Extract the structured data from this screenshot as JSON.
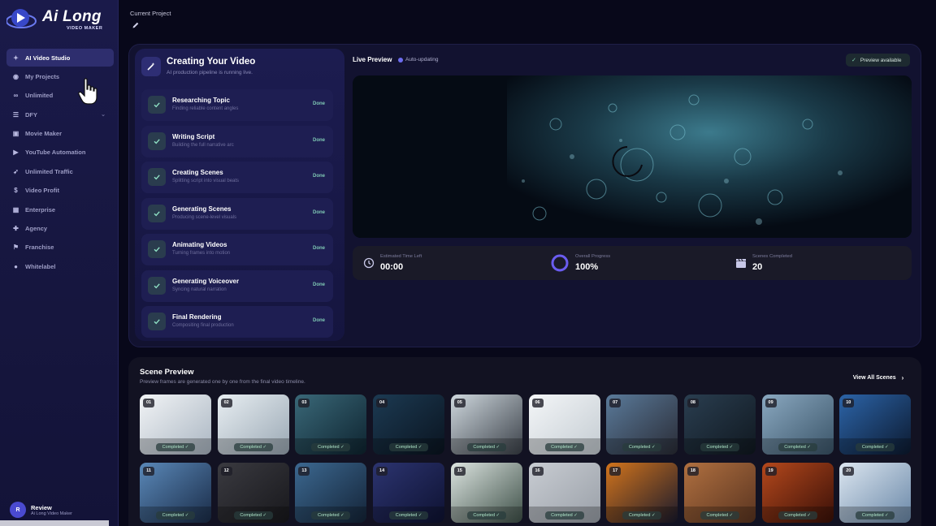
{
  "brand": {
    "name": "Ai Long",
    "subtitle": "VIDEO MAKER"
  },
  "sidebar": {
    "items": [
      {
        "label": "AI Video Studio",
        "icon": "magic-wand-icon",
        "active": true
      },
      {
        "label": "My Projects",
        "icon": "play-circle-icon",
        "active": false
      },
      {
        "label": "Unlimited",
        "icon": "infinity-icon",
        "active": false
      },
      {
        "label": "DFY",
        "icon": "layers-icon",
        "active": false,
        "chevron": true
      },
      {
        "label": "Movie Maker",
        "icon": "film-icon",
        "active": false
      },
      {
        "label": "YouTube Automation",
        "icon": "youtube-icon",
        "active": false
      },
      {
        "label": "Unlimited Traffic",
        "icon": "rocket-icon",
        "active": false
      },
      {
        "label": "Video Profit",
        "icon": "money-bag-icon",
        "active": false
      },
      {
        "label": "Enterprise",
        "icon": "building-icon",
        "active": false
      },
      {
        "label": "Agency",
        "icon": "handshake-icon",
        "active": false
      },
      {
        "label": "Franchise",
        "icon": "flag-icon",
        "active": false
      },
      {
        "label": "Whitelabel",
        "icon": "badge-icon",
        "active": false
      }
    ]
  },
  "user": {
    "initial": "R",
    "name": "Review",
    "subtitle": "Ai Long Video Maker"
  },
  "header": {
    "current_project_label": "Current Project"
  },
  "pipeline": {
    "title": "Creating Your Video",
    "subtitle": "AI production pipeline is running live.",
    "steps": [
      {
        "title": "Researching Topic",
        "subtitle": "Finding reliable content angles",
        "status": "Done"
      },
      {
        "title": "Writing Script",
        "subtitle": "Building the full narrative arc",
        "status": "Done"
      },
      {
        "title": "Creating Scenes",
        "subtitle": "Splitting script into visual beats",
        "status": "Done"
      },
      {
        "title": "Generating Scenes",
        "subtitle": "Producing scene-level visuals",
        "status": "Done"
      },
      {
        "title": "Animating Videos",
        "subtitle": "Turning frames into motion",
        "status": "Done"
      },
      {
        "title": "Generating Voiceover",
        "subtitle": "Syncing natural narration",
        "status": "Done"
      },
      {
        "title": "Final Rendering",
        "subtitle": "Compositing final production",
        "status": "Done"
      }
    ]
  },
  "live_preview": {
    "title": "Live Preview",
    "status": "Auto-updating",
    "badge": "Preview available"
  },
  "stats": {
    "time_left_label": "Estimated Time Left",
    "time_left_value": "00:00",
    "progress_label": "Overall Progress",
    "progress_value": "100%",
    "progress_fraction": 1.0,
    "scenes_label": "Scenes Completed",
    "scenes_value": "20"
  },
  "scene_preview": {
    "title": "Scene Preview",
    "subtitle": "Preview frames are generated one by one from the final video timeline.",
    "view_all": "View All Scenes",
    "completed_label": "Completed",
    "scenes": [
      {
        "num": "01",
        "colors": [
          "#f2f4f6",
          "#aab6c2"
        ]
      },
      {
        "num": "02",
        "colors": [
          "#e8eef2",
          "#9aa8b4"
        ]
      },
      {
        "num": "03",
        "colors": [
          "#3a6878",
          "#0e2430"
        ]
      },
      {
        "num": "04",
        "colors": [
          "#1c3a52",
          "#0a1420"
        ]
      },
      {
        "num": "05",
        "colors": [
          "#cfd8de",
          "#3a4048"
        ]
      },
      {
        "num": "06",
        "colors": [
          "#f4f6f8",
          "#c4ccd2"
        ]
      },
      {
        "num": "07",
        "colors": [
          "#5a7a9a",
          "#2a2c36"
        ]
      },
      {
        "num": "08",
        "colors": [
          "#2a3e50",
          "#101820"
        ]
      },
      {
        "num": "09",
        "colors": [
          "#8aa8c0",
          "#3a5468"
        ]
      },
      {
        "num": "10",
        "colors": [
          "#2c64a8",
          "#0c1a30"
        ]
      },
      {
        "num": "11",
        "colors": [
          "#5a88b8",
          "#1a2c48"
        ]
      },
      {
        "num": "12",
        "colors": [
          "#3a3a40",
          "#18181c"
        ]
      },
      {
        "num": "13",
        "colors": [
          "#3c6890",
          "#142438"
        ]
      },
      {
        "num": "14",
        "colors": [
          "#2c3470",
          "#0e1232"
        ]
      },
      {
        "num": "15",
        "colors": [
          "#dce4e0",
          "#3e5048"
        ]
      },
      {
        "num": "16",
        "colors": [
          "#c8ccd2",
          "#9aa0a8"
        ]
      },
      {
        "num": "17",
        "colors": [
          "#d2741c",
          "#1a1a2c"
        ]
      },
      {
        "num": "18",
        "colors": [
          "#b07040",
          "#5a3420"
        ]
      },
      {
        "num": "19",
        "colors": [
          "#b4481c",
          "#3a1008"
        ]
      },
      {
        "num": "20",
        "colors": [
          "#dce6f0",
          "#6a88a8"
        ]
      }
    ]
  },
  "colors": {
    "accent": "#5a5af0",
    "done": "#7fc8b4",
    "sidebar_active": "#2e2e6e"
  }
}
